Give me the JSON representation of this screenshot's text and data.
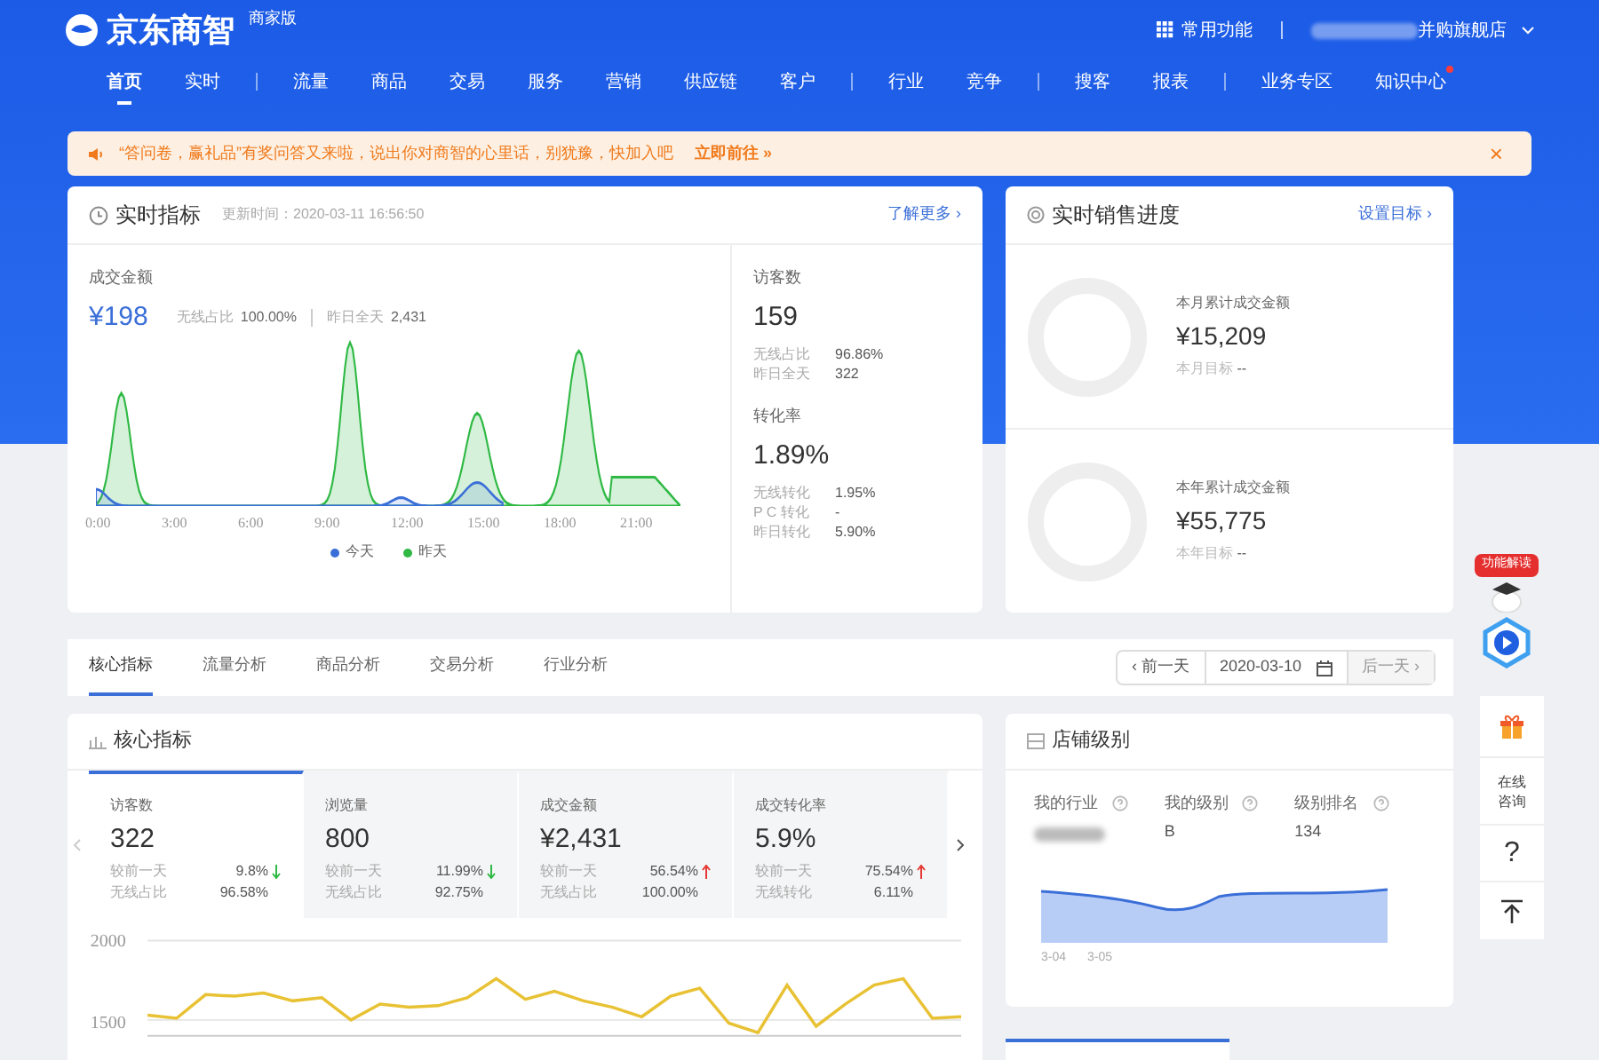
{
  "header": {
    "logo": "京东商智",
    "edition": "商家版",
    "apps": "常用功能",
    "store": "并购旗舰店"
  },
  "nav": [
    [
      {
        "label": "首页",
        "selected": true,
        "dot": false
      },
      {
        "label": "实时",
        "selected": false,
        "dot": false
      }
    ],
    [
      {
        "label": "流量",
        "selected": false,
        "dot": false
      },
      {
        "label": "商品",
        "selected": false,
        "dot": false
      },
      {
        "label": "交易",
        "selected": false,
        "dot": false
      },
      {
        "label": "服务",
        "selected": false,
        "dot": false
      },
      {
        "label": "营销",
        "selected": false,
        "dot": false
      },
      {
        "label": "供应链",
        "selected": false,
        "dot": false
      },
      {
        "label": "客户",
        "selected": false,
        "dot": false
      }
    ],
    [
      {
        "label": "行业",
        "selected": false,
        "dot": false
      },
      {
        "label": "竞争",
        "selected": false,
        "dot": false
      }
    ],
    [
      {
        "label": "搜客",
        "selected": false,
        "dot": false
      },
      {
        "label": "报表",
        "selected": false,
        "dot": false
      }
    ],
    [
      {
        "label": "业务专区",
        "selected": false,
        "dot": false
      },
      {
        "label": "知识中心",
        "selected": false,
        "dot": true
      }
    ]
  ],
  "notice": {
    "text": "“答问卷，赢礼品”有奖问答又来啦，说出你对商智的心里话，别犹豫，快加入吧",
    "link": "立即前往 »",
    "close": "×"
  },
  "realtime": {
    "title": "实时指标",
    "updated": "更新时间：2020-03-11 16:56:50",
    "more": "了解更多 ›",
    "main": {
      "label": "成交金额",
      "value": "¥198",
      "share_label": "无线占比",
      "share": "100.00%",
      "yday_label": "昨日全天",
      "yday": "2,431"
    },
    "xticks": [
      "0:00",
      "3:00",
      "6:00",
      "9:00",
      "12:00",
      "15:00",
      "18:00",
      "21:00"
    ],
    "legend": [
      {
        "label": "今天",
        "color": "#3b6fd8"
      },
      {
        "label": "昨天",
        "color": "#2fb944"
      }
    ],
    "stats": [
      {
        "label": "访客数",
        "value": "159",
        "rows": [
          {
            "label": "无线占比",
            "value": "96.86%"
          },
          {
            "label": "昨日全天",
            "value": "322"
          }
        ]
      },
      {
        "label": "转化率",
        "value": "1.89%",
        "rows": [
          {
            "label": "无线转化",
            "value": "1.95%"
          },
          {
            "label": "P C 转化",
            "value": "-"
          },
          {
            "label": "昨日转化",
            "value": "5.90%"
          }
        ]
      }
    ]
  },
  "sales": {
    "title": "实时销售进度",
    "link": "设置目标 ›",
    "items": [
      {
        "label": "本月累计成交金额",
        "value": "¥15,209",
        "target_label": "本月目标",
        "target": "--"
      },
      {
        "label": "本年累计成交金额",
        "value": "¥55,775",
        "target_label": "本年目标",
        "target": "--"
      }
    ]
  },
  "tabs": [
    {
      "label": "核心指标",
      "selected": true
    },
    {
      "label": "流量分析",
      "selected": false
    },
    {
      "label": "商品分析",
      "selected": false
    },
    {
      "label": "交易分析",
      "selected": false
    },
    {
      "label": "行业分析",
      "selected": false
    }
  ],
  "date": {
    "prev": "‹ 前一天",
    "value": "2020-03-10",
    "next": "后一天 ›",
    "next_disabled": true
  },
  "core": {
    "title": "核心指标",
    "cards": [
      {
        "label": "访客数",
        "value": "322",
        "selected": true,
        "rows": [
          {
            "kind": "down",
            "label": "较前一天",
            "value": "9.8%"
          },
          {
            "kind": "plain",
            "label": "无线占比",
            "value": "96.58%"
          }
        ]
      },
      {
        "label": "浏览量",
        "value": "800",
        "selected": false,
        "rows": [
          {
            "kind": "down",
            "label": "较前一天",
            "value": "11.99%"
          },
          {
            "kind": "plain",
            "label": "无线占比",
            "value": "92.75%"
          }
        ]
      },
      {
        "label": "成交金额",
        "value": "¥2,431",
        "selected": false,
        "rows": [
          {
            "kind": "up",
            "label": "较前一天",
            "value": "56.54%"
          },
          {
            "kind": "plain",
            "label": "无线占比",
            "value": "100.00%"
          }
        ]
      },
      {
        "label": "成交转化率",
        "value": "5.9%",
        "selected": false,
        "rows": [
          {
            "kind": "up",
            "label": "较前一天",
            "value": "75.54%"
          },
          {
            "kind": "plain",
            "label": "无线转化",
            "value": "6.11%"
          }
        ]
      }
    ],
    "chart_data": {
      "type": "line",
      "ylim": [
        1400,
        2000
      ],
      "yticks": [
        1500,
        2000
      ],
      "series": [
        {
          "color": "#e8c234",
          "values": [
            1530,
            1510,
            1660,
            1650,
            1670,
            1620,
            1640,
            1500,
            1600,
            1580,
            1590,
            1640,
            1760,
            1630,
            1680,
            1620,
            1580,
            1520,
            1650,
            1700,
            1480,
            1420,
            1720,
            1460,
            1600,
            1720,
            1760,
            1510,
            1520
          ]
        }
      ]
    }
  },
  "shop": {
    "title": "店铺级别",
    "stats": [
      {
        "label": "我的行业",
        "blurred": true
      },
      {
        "label": "我的级别",
        "value": "B",
        "blurred": false
      },
      {
        "label": "级别排名",
        "value": "134",
        "blurred": false
      }
    ],
    "xticks": [
      "3-04",
      "3-05"
    ]
  },
  "tools": {
    "badge": "功能解读",
    "consult": "在线咨询",
    "help": "?"
  }
}
